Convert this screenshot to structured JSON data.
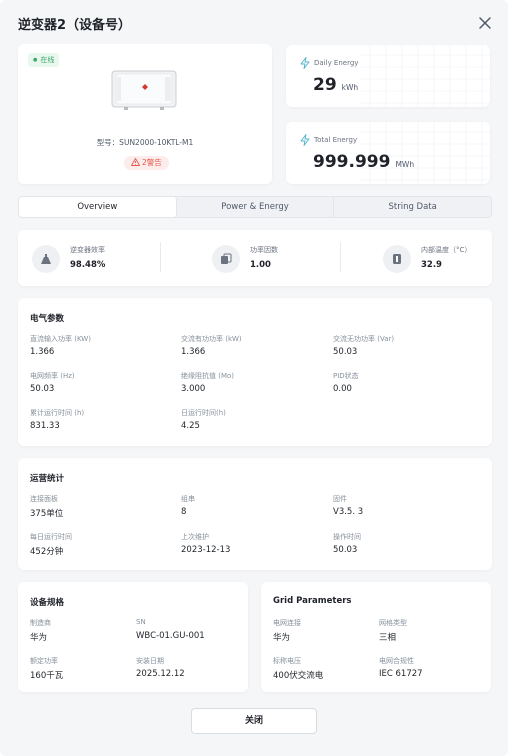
{
  "dialog": {
    "title": "逆变器2（设备号）",
    "close_label": "关闭"
  },
  "device": {
    "status": "在线",
    "model_label": "型号：SUN2000-10KTL-M1",
    "warning": "2警告"
  },
  "energy": {
    "daily": {
      "label": "Daily Energy",
      "value": "29",
      "unit": "kWh"
    },
    "total": {
      "label": "Total Energy",
      "value": "999.999",
      "unit": "MWh"
    }
  },
  "tabs": [
    {
      "label": "Overview",
      "active": true
    },
    {
      "label": "Power & Energy",
      "active": false
    },
    {
      "label": "String Data",
      "active": false
    }
  ],
  "kpis": [
    {
      "label": "逆变器效率",
      "value": "98.48%",
      "icon": "efficiency-icon"
    },
    {
      "label": "功率因数",
      "value": "1.00",
      "icon": "power-factor-icon"
    },
    {
      "label": "内部温度（°C）",
      "value": "32.9",
      "icon": "thermometer-icon"
    }
  ],
  "electrical": {
    "title": "电气参数",
    "fields": [
      {
        "label": "直流输入功率 (KW)",
        "value": "1.366"
      },
      {
        "label": "交流有功功率 (kW)",
        "value": "1.366"
      },
      {
        "label": "交流无功功率 (Var)",
        "value": "50.03"
      },
      {
        "label": "电网频率 (Hz)",
        "value": "50.03"
      },
      {
        "label": "绝缘阻抗值 (Mo)",
        "value": "3.000"
      },
      {
        "label": "PID状态",
        "value": "0.00"
      },
      {
        "label": "累计运行时间 (h)",
        "value": "831.33"
      },
      {
        "label": "日运行时间(h)",
        "value": "4.25"
      }
    ]
  },
  "operations": {
    "title": "运营统计",
    "fields": [
      {
        "label": "连接面板",
        "value": "375单位"
      },
      {
        "label": "组串",
        "value": "8"
      },
      {
        "label": "固件",
        "value": "V3.5. 3"
      },
      {
        "label": "每日运行时间",
        "value": "452分钟"
      },
      {
        "label": "上次维护",
        "value": "2023-12-13"
      },
      {
        "label": "操作时间",
        "value": "50.03"
      }
    ]
  },
  "spec": {
    "title": "设备规格",
    "fields": [
      {
        "label": "制造商",
        "value": "华为"
      },
      {
        "label": "SN",
        "value": "WBC-01.GU-001"
      },
      {
        "label": "额定功率",
        "value": "160千瓦"
      },
      {
        "label": "安装日期",
        "value": "2025.12.12"
      }
    ]
  },
  "grid": {
    "title": "Grid Parameters",
    "fields": [
      {
        "label": "电网连接",
        "value": "华为"
      },
      {
        "label": "网格类型",
        "value": "三相"
      },
      {
        "label": "标称电压",
        "value": "400伏交流电"
      },
      {
        "label": "电网合规性",
        "value": "IEC 61727"
      }
    ]
  },
  "colors": {
    "online": "#3aa86b",
    "warning": "#e35b4d",
    "accent": "#4fb3c8"
  }
}
